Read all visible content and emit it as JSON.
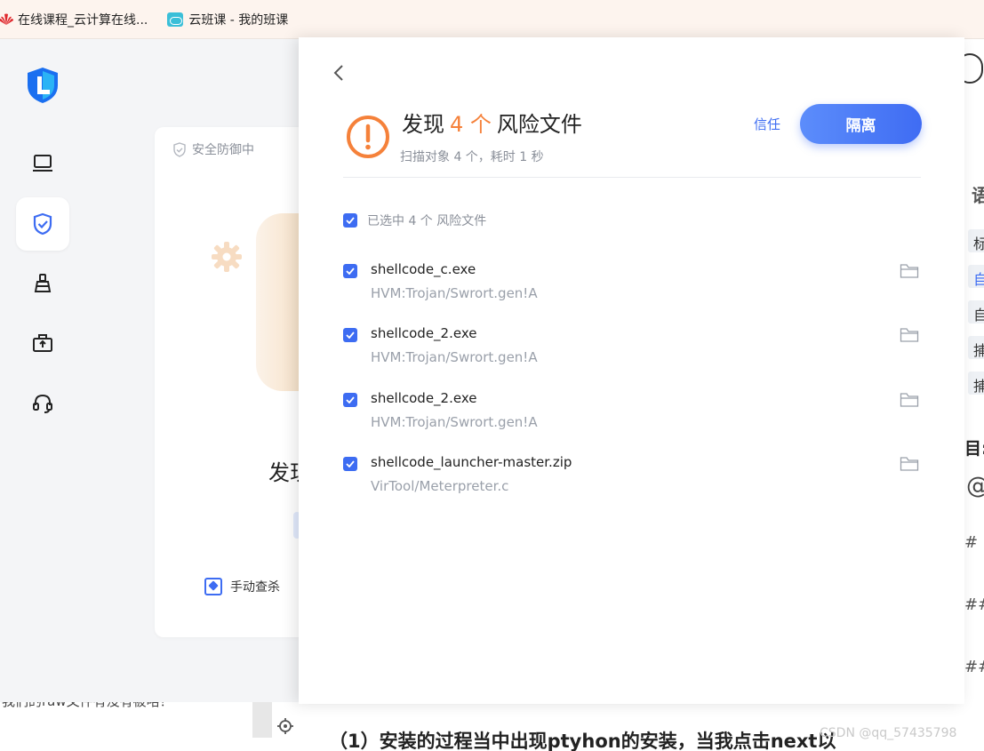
{
  "bookmarks": [
    {
      "label": "在线课程_云计算在线..."
    },
    {
      "label": "云班课 - 我的班课"
    }
  ],
  "sidebar": {
    "items": [
      {
        "icon": "laptop-icon"
      },
      {
        "icon": "shield-check-icon",
        "active": true
      },
      {
        "icon": "broom-icon"
      },
      {
        "icon": "toolbox-icon"
      },
      {
        "icon": "headset-icon"
      }
    ]
  },
  "background_card": {
    "status": "安全防御中",
    "found_partial": "发现",
    "manual_scan": "手动查杀"
  },
  "modal": {
    "title_prefix": "发现",
    "count": "4 个",
    "title_suffix": "风险文件",
    "subtitle": "扫描对象 4 个，耗时 1 秒",
    "trust_label": "信任",
    "isolate_label": "隔离",
    "select_all_label": "已选中 4 个 风险文件",
    "files": [
      {
        "name": "shellcode_c.exe",
        "threat": "HVM:Trojan/Swrort.gen!A",
        "checked": true
      },
      {
        "name": "shellcode_2.exe",
        "threat": "HVM:Trojan/Swrort.gen!A",
        "checked": true
      },
      {
        "name": "shellcode_2.exe",
        "threat": "HVM:Trojan/Swrort.gen!A",
        "checked": true
      },
      {
        "name": "shellcode_launcher-master.zip",
        "threat": "VirTool/Meterpreter.c",
        "checked": true
      }
    ]
  },
  "background_page": {
    "right_fragments": [
      "语",
      "标",
      "自",
      "自",
      "捕",
      "捕",
      "目:",
      "@",
      "#",
      "##",
      "##"
    ],
    "bottom_strip": "我们的raw文件有没有被咯？",
    "bottom_text": "（1）安装的过程当中出现ptyhon的安装，当我点击next以",
    "watermark": "CSDN @qq_57435798"
  },
  "colors": {
    "accent": "#3d6cf2",
    "warning": "#f5813a"
  }
}
